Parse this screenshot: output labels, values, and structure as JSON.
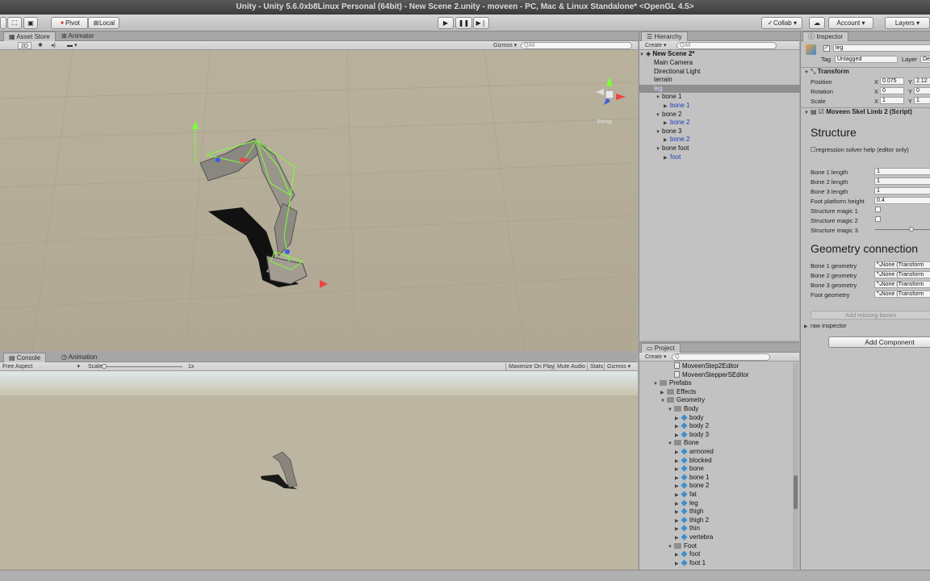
{
  "window": {
    "title": "Unity - Unity 5.6.0xb8Linux Personal (64bit) - New Scene 2.unity - moveen - PC, Mac & Linux Standalone* <OpenGL 4.5>"
  },
  "toolbar": {
    "pivot": "Pivot",
    "local": "Local",
    "collab": "Collab",
    "account": "Account",
    "layers": "Layers",
    "play_icon": "play-icon",
    "pause_icon": "pause-icon",
    "step_icon": "step-icon"
  },
  "scene": {
    "tabs": [
      "Asset Store",
      "Animator"
    ],
    "mode_2d": "2D",
    "gizmos": "Gizmos",
    "search_placeholder": "All",
    "persp": "Persp"
  },
  "game": {
    "tabs": [
      "Console",
      "Animation"
    ],
    "aspect": "Free Aspect",
    "scale_label": "Scale",
    "scale_value": "1x",
    "buttons": [
      "Maximize On Play",
      "Mute Audio",
      "Stats",
      "Gizmos"
    ]
  },
  "hierarchy": {
    "tab": "Hierarchy",
    "create": "Create",
    "search_placeholder": "All",
    "scene_name": "New Scene 2*",
    "items": [
      {
        "label": "Main Camera",
        "indent": 0,
        "blue": false
      },
      {
        "label": "Directional Light",
        "indent": 0,
        "blue": false
      },
      {
        "label": "terrain",
        "indent": 0,
        "blue": false
      },
      {
        "label": "leg",
        "indent": 0,
        "blue": false,
        "selected": true
      },
      {
        "label": "bone 1",
        "indent": 1,
        "blue": false,
        "tri": "▼"
      },
      {
        "label": "bone 1",
        "indent": 2,
        "blue": true,
        "tri": "▶"
      },
      {
        "label": "bone 2",
        "indent": 1,
        "blue": false,
        "tri": "▼"
      },
      {
        "label": "bone 2",
        "indent": 2,
        "blue": true,
        "tri": "▶"
      },
      {
        "label": "bone 3",
        "indent": 1,
        "blue": false,
        "tri": "▼"
      },
      {
        "label": "bone 2",
        "indent": 2,
        "blue": true,
        "tri": "▶"
      },
      {
        "label": "bone foot",
        "indent": 1,
        "blue": false,
        "tri": "▼"
      },
      {
        "label": "foot",
        "indent": 2,
        "blue": true,
        "tri": "▶"
      }
    ]
  },
  "inspector": {
    "tab": "Inspector",
    "object_name": "leg",
    "tag_label": "Tag",
    "tag_value": "Untagged",
    "layer_label": "Layer",
    "layer_value": "Def",
    "transform": {
      "title": "Transform",
      "position_label": "Position",
      "rotation_label": "Rotation",
      "scale_label": "Scale",
      "position": {
        "x": "0.075",
        "y": "2.12"
      },
      "rotation": {
        "x": "0",
        "y": "0"
      },
      "scale": {
        "x": "1",
        "y": "1"
      },
      "x": "X",
      "y": "Y"
    },
    "script_title": "Moveen Skel Limb 2 (Script)",
    "structure_header": "Structure",
    "regression_label": "regression solver help (editor only)",
    "fields": [
      {
        "label": "Bone 1 length",
        "value": "1"
      },
      {
        "label": "Bone 2 length",
        "value": "1"
      },
      {
        "label": "Bone 3 length",
        "value": "1"
      },
      {
        "label": "Foot platform height",
        "value": "0.4"
      }
    ],
    "magic": [
      "Structure magic 1",
      "Structure magic 2",
      "Structure magic 3"
    ],
    "geometry_header": "Geometry connection",
    "geometry": [
      {
        "label": "Bone 1 geometry",
        "value": "None (Transform"
      },
      {
        "label": "Bone 2 geometry",
        "value": "None (Transform"
      },
      {
        "label": "Bone 3 geometry",
        "value": "None (Transform"
      },
      {
        "label": "Foot geometry",
        "value": "None (Transform"
      }
    ],
    "add_missing": "Add missing bones",
    "raw_inspector": "raw inspector",
    "add_component": "Add Component"
  },
  "project": {
    "tab": "Project",
    "create": "Create",
    "items": [
      {
        "label": "MoveenStep2Editor",
        "kind": "script",
        "indent": 3,
        "tri": ""
      },
      {
        "label": "MoveenStepperSEditor",
        "kind": "script",
        "indent": 3,
        "tri": ""
      },
      {
        "label": "Prefabs",
        "kind": "folder",
        "indent": 1,
        "tri": "▼"
      },
      {
        "label": "Effects",
        "kind": "folder",
        "indent": 2,
        "tri": "▶"
      },
      {
        "label": "Geometry",
        "kind": "folder",
        "indent": 2,
        "tri": "▼"
      },
      {
        "label": "Body",
        "kind": "folder",
        "indent": 3,
        "tri": "▼"
      },
      {
        "label": "body",
        "kind": "cube",
        "indent": 4,
        "tri": "▶"
      },
      {
        "label": "body 2",
        "kind": "cube",
        "indent": 4,
        "tri": "▶"
      },
      {
        "label": "body 3",
        "kind": "cube",
        "indent": 4,
        "tri": "▶"
      },
      {
        "label": "Bone",
        "kind": "folder",
        "indent": 3,
        "tri": "▼"
      },
      {
        "label": "armored",
        "kind": "cube",
        "indent": 4,
        "tri": "▶"
      },
      {
        "label": "blocked",
        "kind": "cube",
        "indent": 4,
        "tri": "▶"
      },
      {
        "label": "bone",
        "kind": "cube",
        "indent": 4,
        "tri": "▶"
      },
      {
        "label": "bone 1",
        "kind": "cube",
        "indent": 4,
        "tri": "▶"
      },
      {
        "label": "bone 2",
        "kind": "cube",
        "indent": 4,
        "tri": "▶"
      },
      {
        "label": "fat",
        "kind": "cube",
        "indent": 4,
        "tri": "▶"
      },
      {
        "label": "leg",
        "kind": "cube",
        "indent": 4,
        "tri": "▶"
      },
      {
        "label": "thigh",
        "kind": "cube",
        "indent": 4,
        "tri": "▶"
      },
      {
        "label": "thigh 2",
        "kind": "cube",
        "indent": 4,
        "tri": "▶"
      },
      {
        "label": "thin",
        "kind": "cube",
        "indent": 4,
        "tri": "▶"
      },
      {
        "label": "vertebra",
        "kind": "cube",
        "indent": 4,
        "tri": "▶"
      },
      {
        "label": "Foot",
        "kind": "folder",
        "indent": 3,
        "tri": "▼"
      },
      {
        "label": "foot",
        "kind": "cube",
        "indent": 4,
        "tri": "▶"
      },
      {
        "label": "foot 1",
        "kind": "cube",
        "indent": 4,
        "tri": "▶"
      }
    ]
  },
  "colors": {
    "scene_ground": "#bab39f",
    "sky": "#d8e2e6",
    "accent_blue": "#1a3fb8",
    "gizmo_green": "#7cff3a"
  }
}
